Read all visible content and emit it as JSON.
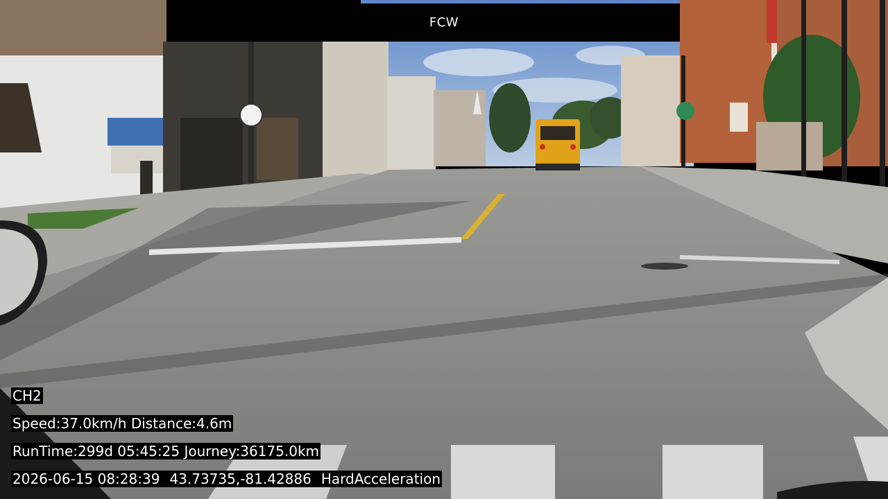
{
  "banner": {
    "label": "FCW"
  },
  "osd": {
    "channel": "CH2",
    "speed": "Speed:37.0km/h",
    "distance": "Distance:4.6m",
    "runtime": "RunTime:299d 05:45:25",
    "journey": "Journey:36175.0km",
    "datetime": "2026-06-15 08:28:39",
    "coordinates": "43.73735,-81.42886",
    "event": "HardAcceleration"
  },
  "scene": {
    "sky_color": "#8fb4dc",
    "road_color": "#8a8a88",
    "center_line_color": "#d9b233",
    "bus_color": "#e0a21a",
    "brick_color": "#b4623c"
  }
}
